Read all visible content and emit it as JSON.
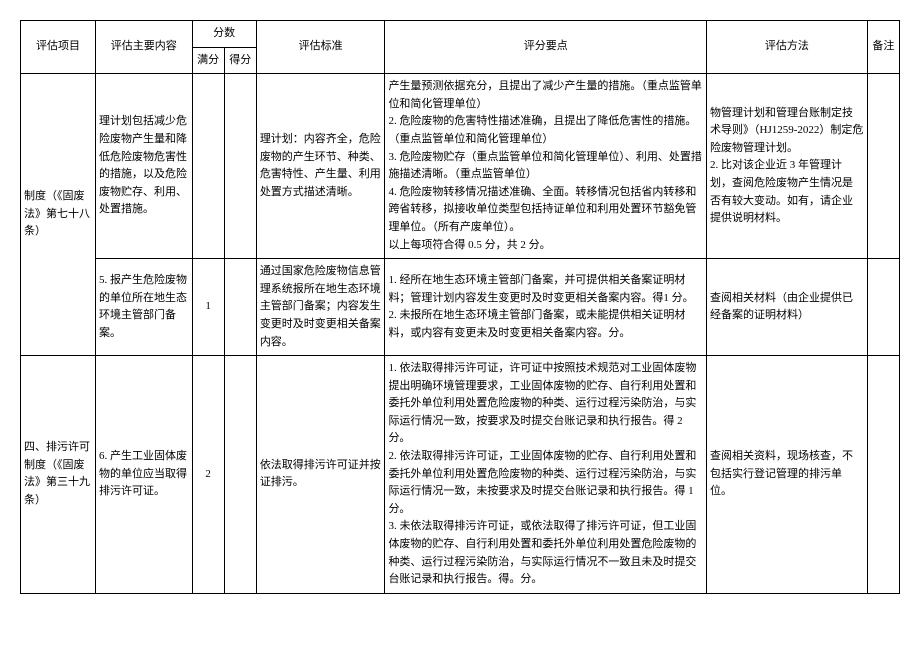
{
  "header": {
    "project": "评估项目",
    "content": "评估主要内容",
    "score": "分数",
    "full": "满分",
    "got": "得分",
    "standard": "评估标准",
    "points": "评分要点",
    "method": "评估方法",
    "note": "备注"
  },
  "rows": [
    {
      "project": "制度（《固废法》第七十八条）",
      "content": "理计划包括减少危险废物产生量和降低危险废物危害性的措施，以及危险废物贮存、利用、处置措施。",
      "full": "",
      "got": "",
      "standard": "理计划：内容齐全，危险废物的产生环节、种类、危害特性、产生量、利用处置方式描述清晰。",
      "pointsText": "产生量预测依据充分，且提出了减少产生量的措施。（重点监管单位和简化管理单位）\n2. 危险废物的危害特性描述准确，且提出了降低危害性的措施。（重点监管单位和简化管理单位）\n3. 危险废物贮存（重点监管单位和简化管理单位）、利用、处置措施描述清晰。（重点监管单位）\n4. 危险废物转移情况描述准确、全面。转移情况包括省内转移和跨省转移，拟接收单位类型包括持证单位和利用处置环节豁免管理单位。（所有产废单位）。\n以上每项符合得 0.5 分，共 2 分。",
      "method": "物管理计划和管理台账制定技术导则》（HJ1259-2022）制定危险废物管理计划。\n2. 比对该企业近 3 年管理计划，查阅危险废物产生情况是否有较大变动。如有，请企业提供说明材料。",
      "note": ""
    },
    {
      "project": "",
      "content": "5. 报产生危险废物的单位所在地生态环境主管部门备案。",
      "full": "1",
      "got": "",
      "standard": "通过国家危险废物信息管理系统报所在地生态环境主管部门备案；内容发生变更时及时变更相关备案内容。",
      "pointsText": "1. 经所在地生态环境主管部门备案，并可提供相关备案证明材料；管理计划内容发生变更时及时变更相关备案内容。得1 分。\n2. 未报所在地生态环境主管部门备案，或未能提供相关证明材料，或内容有变更未及时变更相关备案内容。分。",
      "method": "查阅相关材料（由企业提供已经备案的证明材料）",
      "note": ""
    },
    {
      "project": "四、排污许可制度（《固废法》第三十九条）",
      "content": "6. 产生工业固体废物的单位应当取得排污许可证。",
      "full": "2",
      "got": "",
      "standard": "依法取得排污许可证并按证排污。",
      "pointsText": "1. 依法取得排污许可证，许可证中按照技术规范对工业固体废物提出明确环境管理要求，工业固体废物的贮存、自行利用处置和委托外单位利用处置危险废物的种类、运行过程污染防治，与实际运行情况一致，按要求及时提交台账记录和执行报告。得 2 分。\n2. 依法取得排污许可证，工业固体废物的贮存、自行利用处置和委托外单位利用处置危险废物的种类、运行过程污染防治，与实际运行情况一致，未按要求及时提交台账记录和执行报告。得 1 分。\n3. 未依法取得排污许可证，或依法取得了排污许可证，但工业固体废物的贮存、自行利用处置和委托外单位利用处置危险废物的种类、运行过程污染防治，与实际运行情况不一致且未及时提交台账记录和执行报告。得。分。",
      "method": "查阅相关资料，现场核查，不包括实行登记管理的排污单位。",
      "note": ""
    }
  ]
}
